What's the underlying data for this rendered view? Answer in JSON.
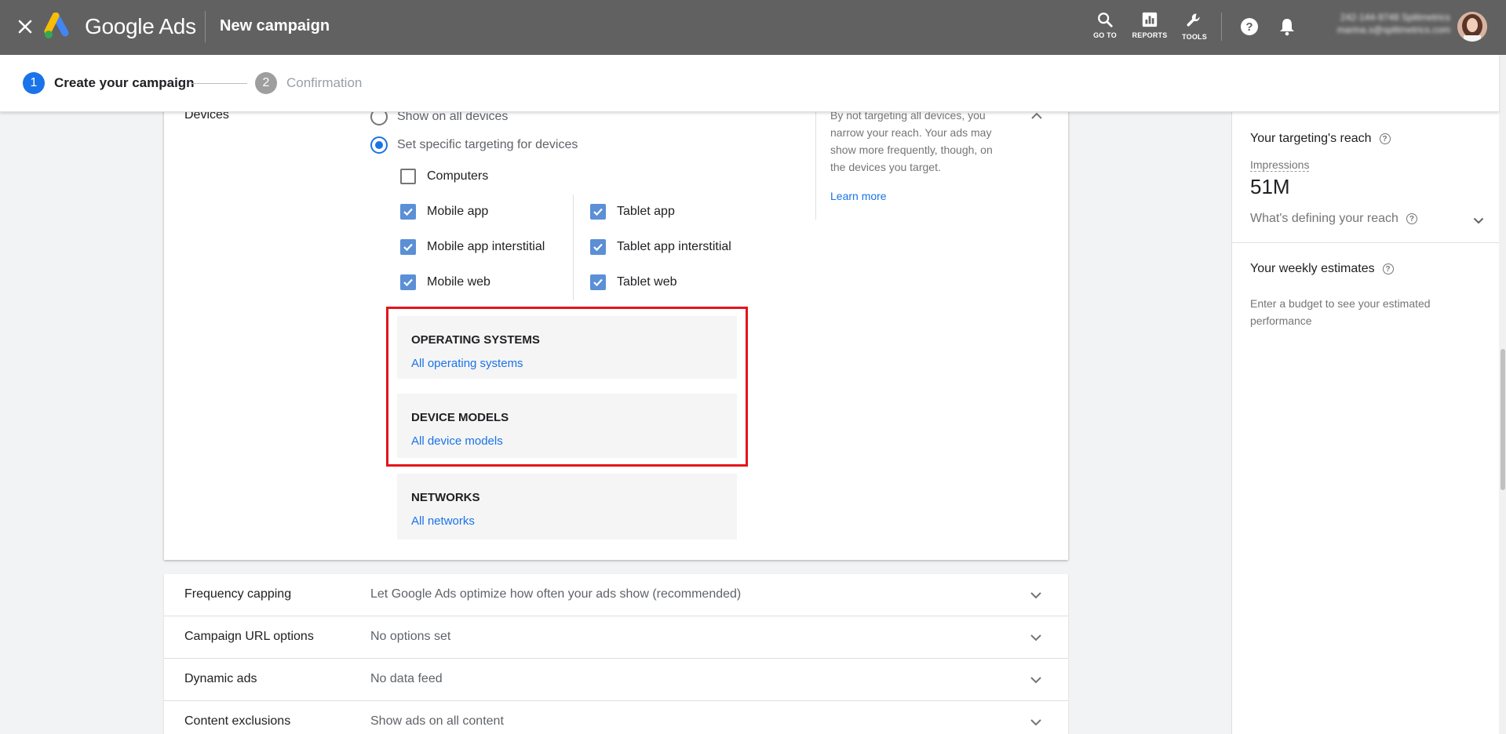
{
  "header": {
    "brand": "Google Ads",
    "title": "New campaign",
    "tools": [
      {
        "label": "GO TO",
        "icon": "search-icon"
      },
      {
        "label": "REPORTS",
        "icon": "bar-chart-icon"
      },
      {
        "label": "TOOLS",
        "icon": "wrench-icon"
      }
    ],
    "account_id": "242-144-9748 Splitmetrics",
    "account_email": "marina.s@splitmetrics.com"
  },
  "stepper": {
    "step1_num": "1",
    "step1_label": "Create your campaign",
    "step2_num": "2",
    "step2_label": "Confirmation"
  },
  "devices": {
    "label": "Devices",
    "radio_all": "Show on all devices",
    "radio_specific": "Set specific targeting for devices",
    "selected": "specific",
    "computers": "Computers",
    "left_column": [
      "Mobile app",
      "Mobile app interstitial",
      "Mobile web"
    ],
    "right_column": [
      "Tablet app",
      "Tablet app interstitial",
      "Tablet web"
    ],
    "help_text": "By not targeting all devices, you narrow your reach. Your ads may show more frequently, though, on the devices you target.",
    "learn_more": "Learn more",
    "panels": [
      {
        "title": "OPERATING SYSTEMS",
        "link": "All operating systems"
      },
      {
        "title": "DEVICE MODELS",
        "link": "All device models"
      },
      {
        "title": "NETWORKS",
        "link": "All networks"
      }
    ]
  },
  "rows": [
    {
      "label": "Frequency capping",
      "value": "Let Google Ads optimize how often your ads show (recommended)"
    },
    {
      "label": "Campaign URL options",
      "value": "No options set"
    },
    {
      "label": "Dynamic ads",
      "value": "No data feed"
    },
    {
      "label": "Content exclusions",
      "value": "Show ads on all content"
    }
  ],
  "right_panel": {
    "reach_title": "Your targeting's reach",
    "impressions_label": "Impressions",
    "impressions_value": "51M",
    "defining_label": "What's defining your reach",
    "weekly_title": "Your weekly estimates",
    "weekly_desc": "Enter a budget to see your estimated performance"
  },
  "colors": {
    "header_bg": "#616161",
    "accent_blue": "#1a73e8",
    "checkbox_blue": "#5b8fd6",
    "highlight_red": "#e5141b"
  }
}
